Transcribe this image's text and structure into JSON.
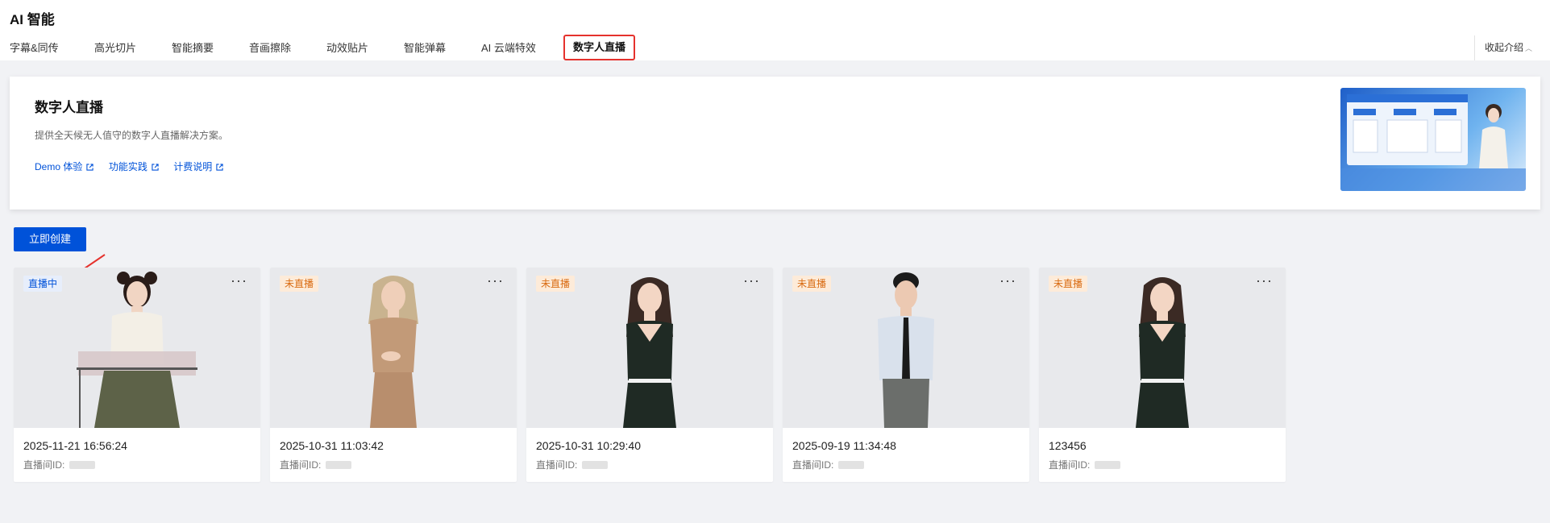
{
  "app": {
    "title": "AI 智能"
  },
  "tabs": [
    {
      "label": "字幕&同传"
    },
    {
      "label": "高光切片"
    },
    {
      "label": "智能摘要"
    },
    {
      "label": "音画擦除"
    },
    {
      "label": "动效贴片"
    },
    {
      "label": "智能弹幕"
    },
    {
      "label": "AI 云端特效"
    },
    {
      "label": "数字人直播",
      "active": true
    }
  ],
  "collapse": {
    "label": "收起介绍",
    "icon": "chevron-up-icon"
  },
  "intro": {
    "title": "数字人直播",
    "description": "提供全天候无人值守的数字人直播解决方案。",
    "links": [
      {
        "label": "Demo 体验",
        "icon": "external-link-icon"
      },
      {
        "label": "功能实践",
        "icon": "external-link-icon"
      },
      {
        "label": "计费说明",
        "icon": "external-link-icon"
      }
    ]
  },
  "actions": {
    "create_label": "立即创建"
  },
  "cards": [
    {
      "status": "直播中",
      "status_type": "live",
      "title": "2025-11-21 16:56:24",
      "id_label": "直播间ID:"
    },
    {
      "status": "未直播",
      "status_type": "off",
      "title": "2025-10-31 11:03:42",
      "id_label": "直播间ID:"
    },
    {
      "status": "未直播",
      "status_type": "off",
      "title": "2025-10-31 10:29:40",
      "id_label": "直播间ID:"
    },
    {
      "status": "未直播",
      "status_type": "off",
      "title": "2025-09-19 11:34:48",
      "id_label": "直播间ID:"
    },
    {
      "status": "未直播",
      "status_type": "off",
      "title": "123456",
      "id_label": "直播间ID:"
    }
  ],
  "colors": {
    "primary": "#0052d9",
    "live_badge_bg": "#e7eefb",
    "off_badge_bg": "#fdebd9",
    "off_badge_text": "#d96b12",
    "active_tab_border": "#e5322d"
  }
}
